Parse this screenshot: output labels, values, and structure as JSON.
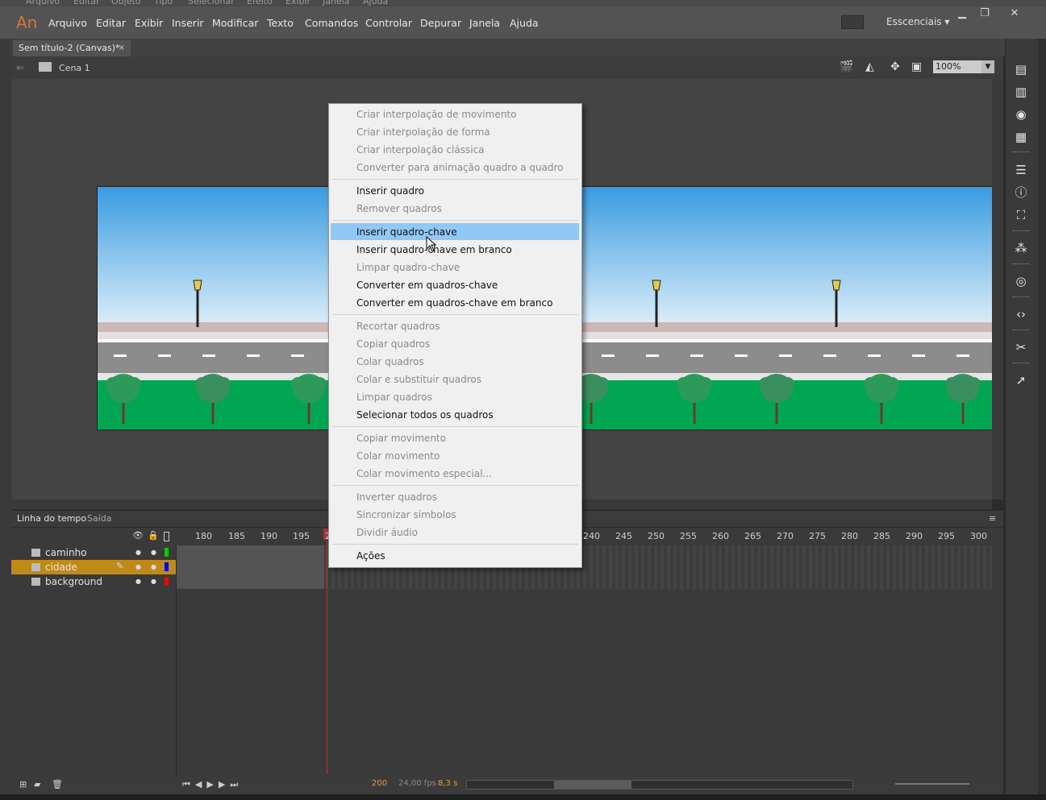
{
  "background_menubar": [
    "Arquivo",
    "Editar",
    "Objeto",
    "Tipo",
    "Selecionar",
    "Efeito",
    "Exibir",
    "Janela",
    "Ajuda"
  ],
  "app": {
    "logo": "An",
    "workspace": "Esscenciais"
  },
  "menubar": {
    "items": [
      "Arquivo",
      "Editar",
      "Exibir",
      "Inserir",
      "Modificar",
      "Texto",
      "Comandos",
      "Controlar",
      "Depurar",
      "Janela",
      "Ajuda"
    ]
  },
  "document": {
    "tab_title": "Sem título-2 (Canvas)*",
    "close": "×"
  },
  "editbar": {
    "scene": "Cena 1",
    "zoom": "100%"
  },
  "timeline": {
    "tabs": [
      "Linha do tempo",
      "Saída"
    ],
    "frame_numbers": [
      "180",
      "185",
      "190",
      "195",
      "2",
      "240",
      "245",
      "250",
      "255",
      "260",
      "265",
      "270",
      "275",
      "280",
      "285",
      "290",
      "295",
      "300"
    ],
    "layers": [
      {
        "name": "caminho",
        "color": "#00cc00"
      },
      {
        "name": "cidade",
        "color": "#0000ff"
      },
      {
        "name": "background",
        "color": "#ff0000"
      }
    ],
    "footer": {
      "frame": "200",
      "fps": "24,00 fps",
      "seconds": "8,3 s"
    }
  },
  "context_menu": {
    "groups": [
      [
        {
          "label": "Criar interpolação de movimento",
          "enabled": false
        },
        {
          "label": "Criar interpolação de forma",
          "enabled": false
        },
        {
          "label": "Criar interpolação clássica",
          "enabled": false
        },
        {
          "label": "Converter para animação quadro a quadro",
          "enabled": false
        }
      ],
      [
        {
          "label": "Inserir quadro",
          "enabled": true
        },
        {
          "label": "Remover quadros",
          "enabled": false
        }
      ],
      [
        {
          "label": "Inserir quadro-chave",
          "enabled": true,
          "highlighted": true
        },
        {
          "label": "Inserir quadro-chave em branco",
          "enabled": true
        },
        {
          "label": "Limpar quadro-chave",
          "enabled": false
        },
        {
          "label": "Converter em quadros-chave",
          "enabled": true
        },
        {
          "label": "Converter em quadros-chave em branco",
          "enabled": true
        }
      ],
      [
        {
          "label": "Recortar quadros",
          "enabled": false
        },
        {
          "label": "Copiar quadros",
          "enabled": false
        },
        {
          "label": "Colar quadros",
          "enabled": false
        },
        {
          "label": "Colar e substituir quadros",
          "enabled": false
        },
        {
          "label": "Limpar quadros",
          "enabled": false
        },
        {
          "label": "Selecionar todos os quadros",
          "enabled": true
        }
      ],
      [
        {
          "label": "Copiar movimento",
          "enabled": false
        },
        {
          "label": "Colar movimento",
          "enabled": false
        },
        {
          "label": "Colar movimento especial...",
          "enabled": false
        }
      ],
      [
        {
          "label": "Inverter quadros",
          "enabled": false
        },
        {
          "label": "Sincronizar símbolos",
          "enabled": false
        },
        {
          "label": "Dividir áudio",
          "enabled": false
        }
      ],
      [
        {
          "label": "Ações",
          "enabled": true
        }
      ]
    ]
  },
  "colors": {
    "sky_top": "#3a9be0",
    "sky_bottom": "#d8ecf8",
    "road": "#8c8c8c",
    "grass": "#00a651",
    "tree": "#2e8b57",
    "highlight": "#90c8f6"
  }
}
